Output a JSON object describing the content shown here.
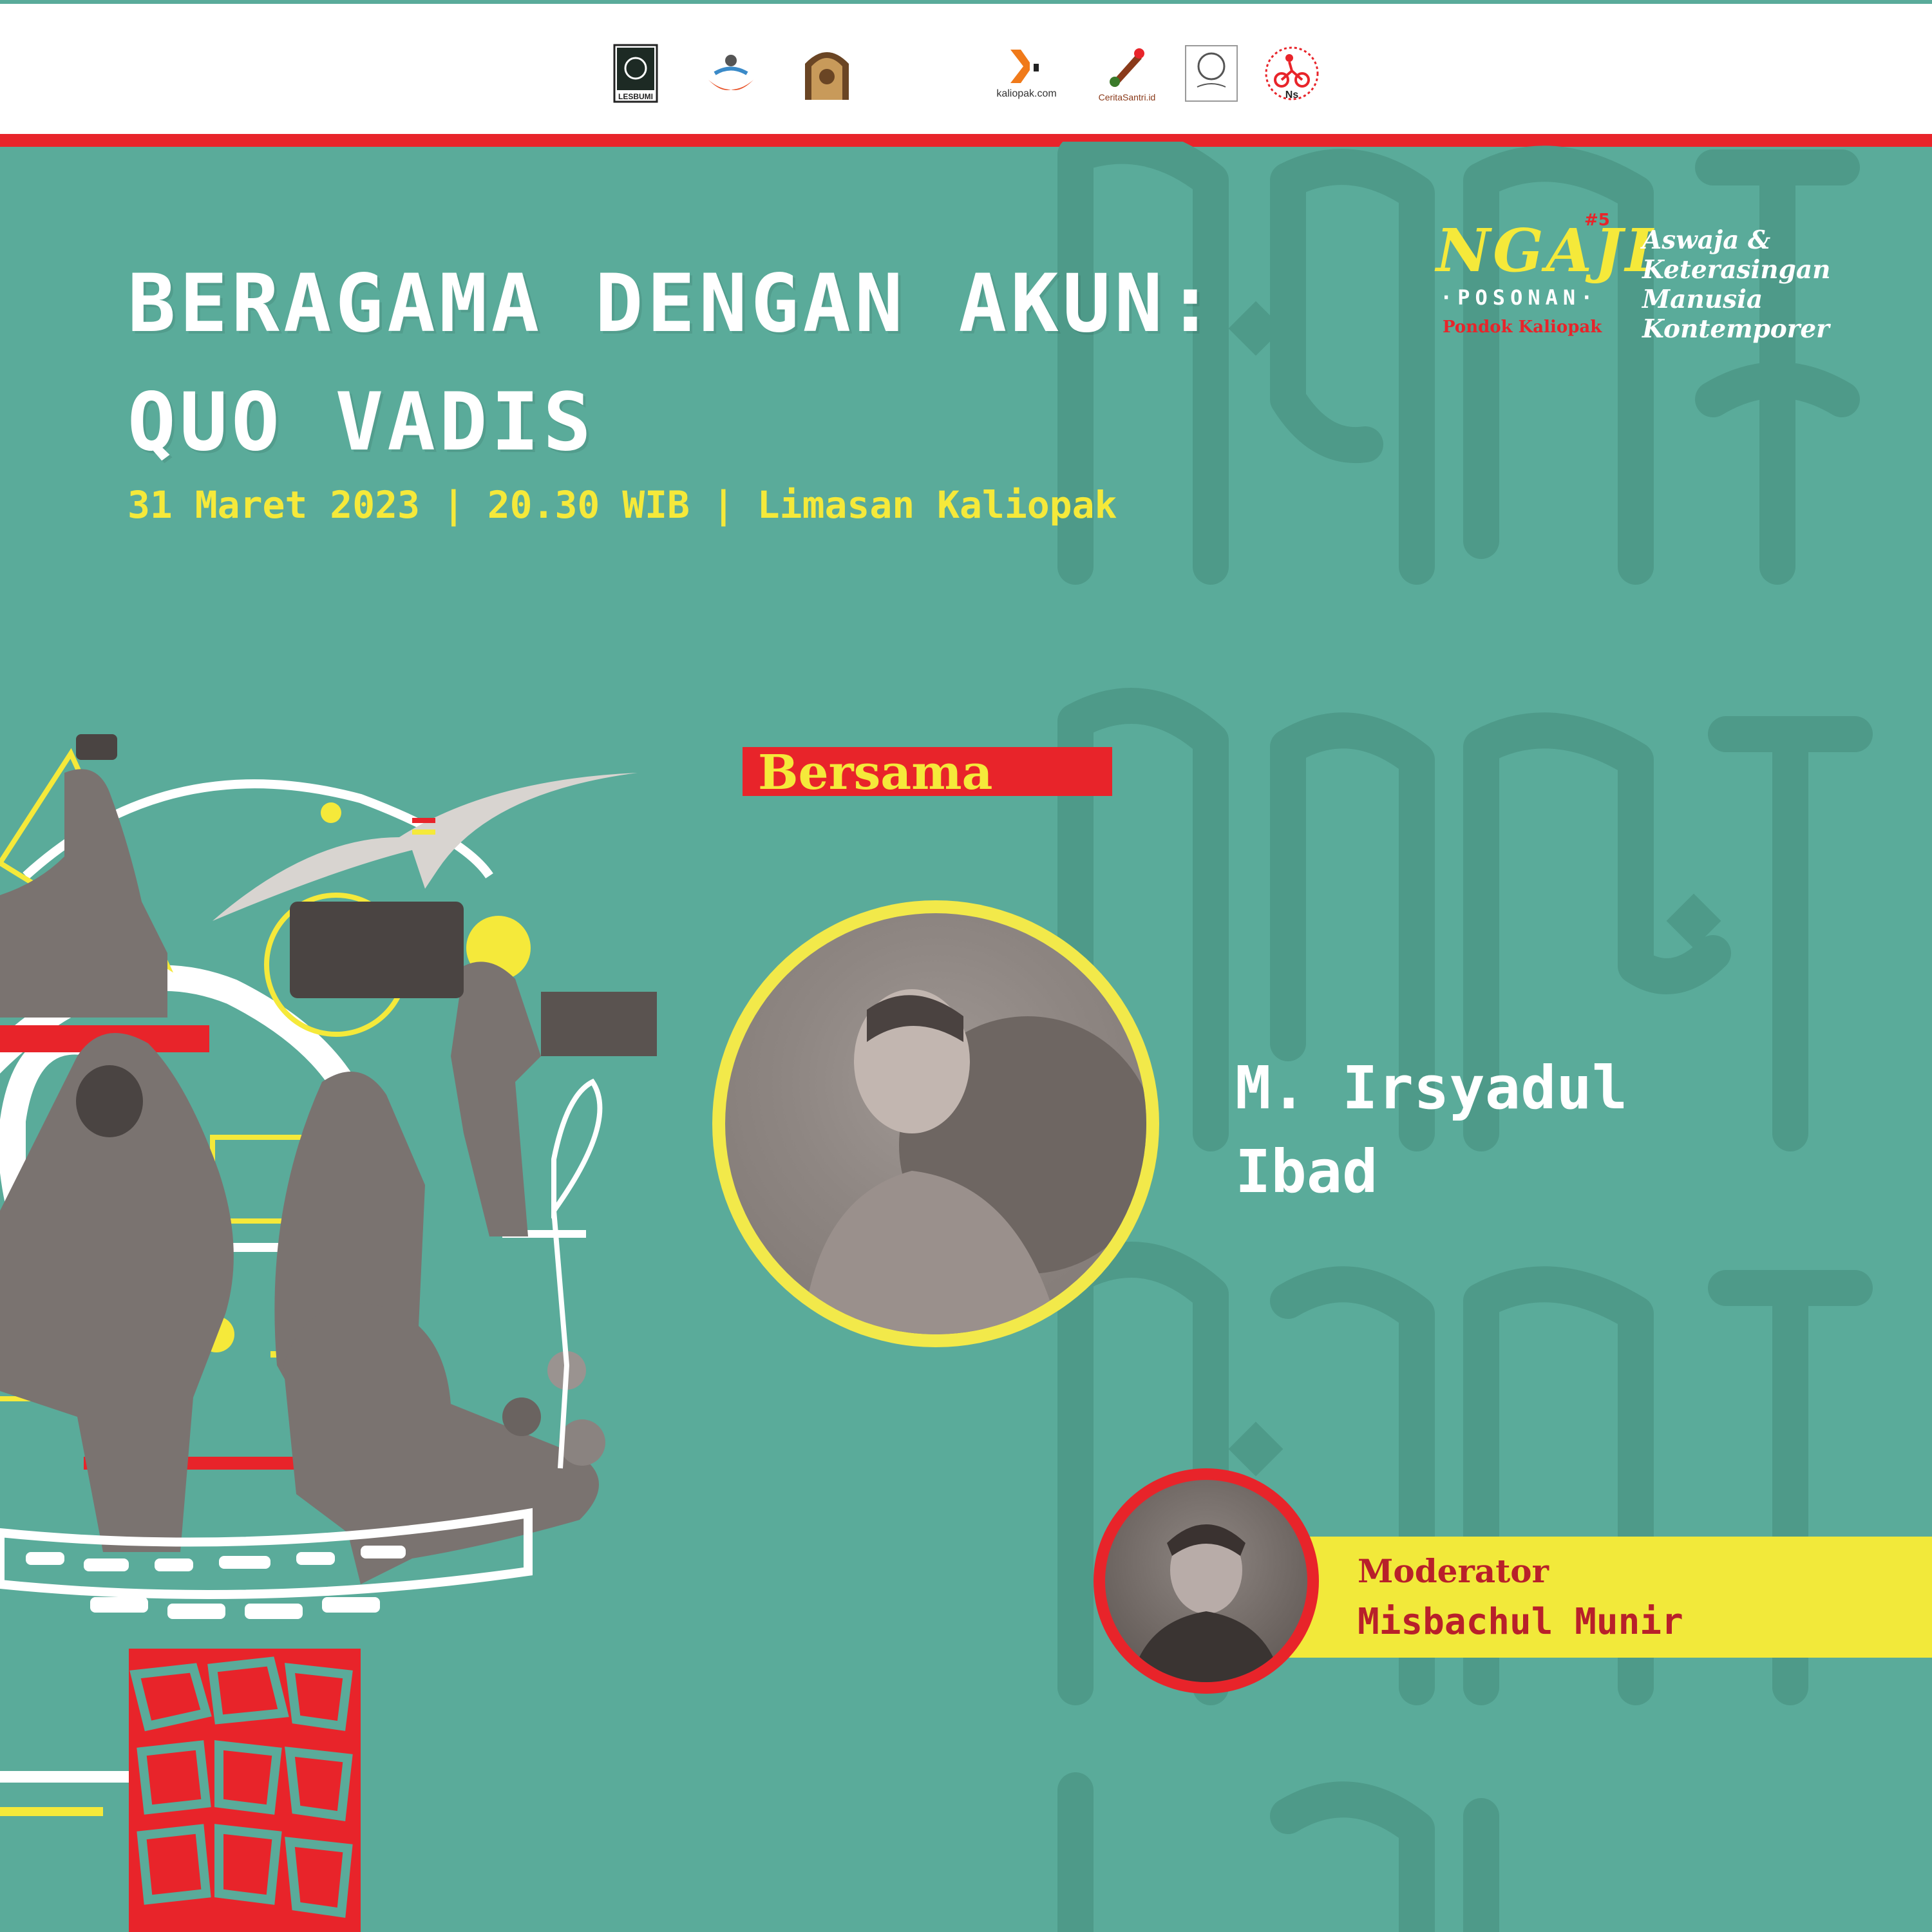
{
  "partner_logos": [
    {
      "name": "lesbumi",
      "label": "LESBUMI"
    },
    {
      "name": "partner-2",
      "label": ""
    },
    {
      "name": "partner-3",
      "label": ""
    },
    {
      "name": "kaliopak",
      "label": "kaliopak.com"
    },
    {
      "name": "ceritasantri",
      "label": "CeritaSantri.id"
    },
    {
      "name": "partner-6",
      "label": ""
    },
    {
      "name": "ns",
      "label": "Ns"
    }
  ],
  "title_line1": "BERAGAMA DENGAN AKUN:",
  "title_line2": "QUO VADIS",
  "event_info": "31 Maret 2023 | 20.30 WIB | Limasan Kaliopak",
  "series": {
    "name": "NGAJI",
    "number": "#5",
    "subtitle": "·POSONAN·",
    "org": "Pondok Kaliopak"
  },
  "theme": [
    "Aswaja &",
    "Keterasingan",
    "Manusia",
    "Kontemporer"
  ],
  "bersama_label": "Bersama",
  "speaker_name_line1": "M. Irsyadul",
  "speaker_name_line2": "Ibad",
  "moderator_label": "Moderator",
  "moderator_name": "Misbachul Munir",
  "colors": {
    "background": "#5aab9a",
    "accent_yellow": "#f5e93a",
    "accent_red": "#e8242a",
    "white": "#ffffff"
  }
}
